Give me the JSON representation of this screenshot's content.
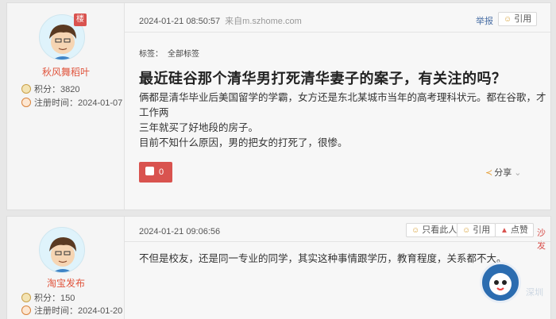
{
  "posts": [
    {
      "user": {
        "name": "秋风舞稻叶",
        "badge": "楼",
        "points": "积分：3820",
        "reg": "注册时间：2024-01-07"
      },
      "time": "2024-01-21 08:50:57",
      "source": "来自m.szhome.com",
      "actions": {
        "report": "举报",
        "quote": "引用"
      },
      "tags_label": "标签：",
      "tags_value": "全部标签",
      "title": "最近硅谷那个清华男打死清华妻子的案子，有关注的吗？",
      "body_lines": [
        "俩都是清华毕业后美国留学的学霸，女方还是东北某城市当年的高考理科状元。都在谷歌，才工作两",
        "三年就买了好地段的房子。",
        "目前不知什么原因，男的把女的打死了，很惨。"
      ],
      "likes": "0",
      "share": "分享"
    },
    {
      "user": {
        "name": "淘宝发布",
        "points": "积分：150",
        "reg": "注册时间：2024-01-20"
      },
      "time": "2024-01-21 09:06:56",
      "actions": {
        "only_this": "只看此人",
        "quote": "引用",
        "like": "点赞",
        "sofa": "沙发"
      },
      "body": "不但是校友，还是同一专业的同学，其实这种事情跟学历，教育程度，关系都不大。"
    }
  ],
  "watermark": {
    "text": "深圳"
  }
}
